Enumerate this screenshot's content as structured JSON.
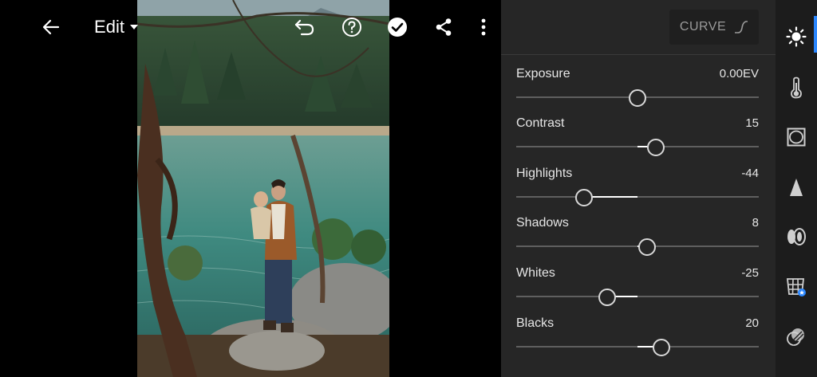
{
  "header": {
    "mode_label": "Edit"
  },
  "panel": {
    "curve_label": "CURVE",
    "adjustments": [
      {
        "name": "Exposure",
        "value": "0.00EV",
        "level": 0.0
      },
      {
        "name": "Contrast",
        "value": "15",
        "level": 0.15
      },
      {
        "name": "Highlights",
        "value": "-44",
        "level": -0.44
      },
      {
        "name": "Shadows",
        "value": "8",
        "level": 0.08
      },
      {
        "name": "Whites",
        "value": "-25",
        "level": -0.25
      },
      {
        "name": "Blacks",
        "value": "20",
        "level": 0.2
      }
    ]
  },
  "colors": {
    "panel_bg": "#262626",
    "rail_bg": "#1c1c1c",
    "active_accent": "#2b87ff",
    "slider_track": "#5f5f5f",
    "slider_fill": "#ffffff"
  },
  "icons": {
    "topbar": [
      "back-arrow-icon",
      "dropdown-caret-icon",
      "undo-icon",
      "help-icon",
      "done-check-icon",
      "share-icon",
      "more-vertical-icon"
    ],
    "rail": [
      "light-icon",
      "color-temperature-icon",
      "effects-vignette-icon",
      "detail-sharpen-icon",
      "optics-lens-icon",
      "geometry-icon",
      "presets-blend-icon"
    ]
  }
}
